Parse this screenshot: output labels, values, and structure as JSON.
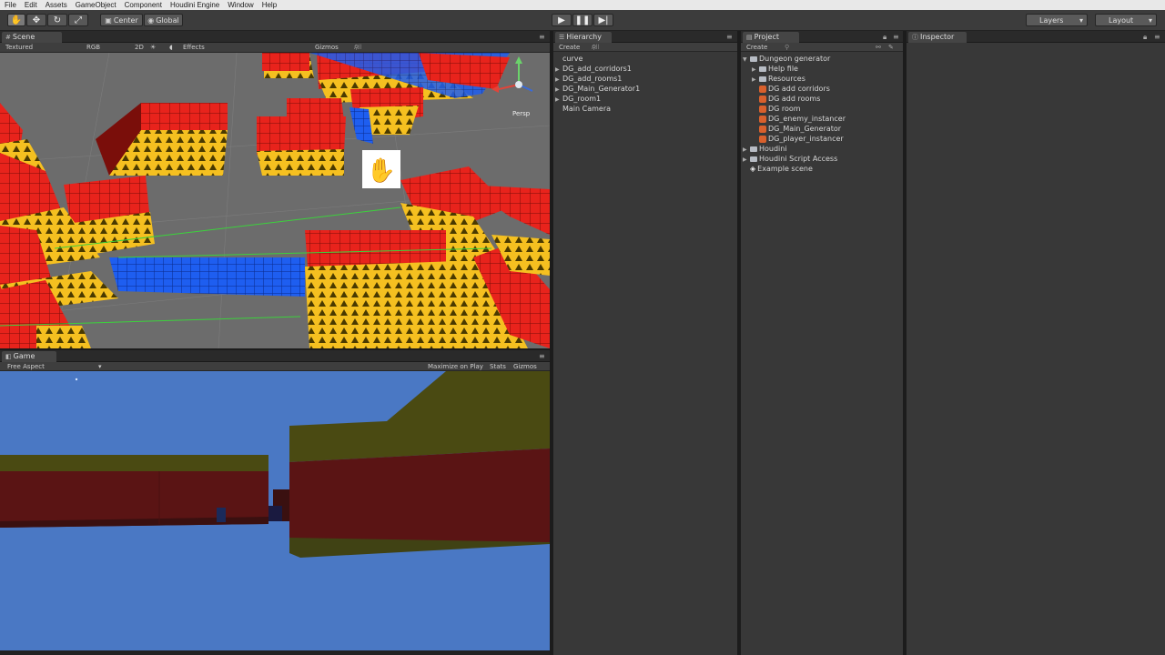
{
  "menu": [
    "File",
    "Edit",
    "Assets",
    "GameObject",
    "Component",
    "Houdini Engine",
    "Window",
    "Help"
  ],
  "toolbar": {
    "tools": [
      "hand-tool",
      "move-tool",
      "rotate-tool",
      "scale-tool"
    ],
    "pivot_mode": "Center",
    "pivot_rotation": "Global",
    "layers_label": "Layers",
    "layout_label": "Layout"
  },
  "scene": {
    "tab_label": "Scene",
    "render_mode": "Textured",
    "color_mode": "RGB",
    "mode_2d": "2D",
    "effects_label": "Effects",
    "gizmos_label": "Gizmos",
    "search_placeholder": "All",
    "persp_label": "Persp"
  },
  "game": {
    "tab_label": "Game",
    "aspect": "Free Aspect",
    "maximize_label": "Maximize on Play",
    "stats_label": "Stats",
    "gizmos_label": "Gizmos"
  },
  "hierarchy": {
    "tab_label": "Hierarchy",
    "create_label": "Create",
    "search_placeholder": "All",
    "items": [
      {
        "label": "curve",
        "expandable": false
      },
      {
        "label": "DG_add_corridors1",
        "expandable": true
      },
      {
        "label": "DG_add_rooms1",
        "expandable": true
      },
      {
        "label": "DG_Main_Generator1",
        "expandable": true
      },
      {
        "label": "DG_room1",
        "expandable": true
      },
      {
        "label": "Main Camera",
        "expandable": false
      }
    ]
  },
  "project": {
    "tab_label": "Project",
    "create_label": "Create",
    "items": [
      {
        "label": "Dungeon generator",
        "type": "folder",
        "expanded": true
      },
      {
        "label": "Help file",
        "type": "folder"
      },
      {
        "label": "Resources",
        "type": "folder"
      },
      {
        "label": "DG add corridors",
        "type": "asset"
      },
      {
        "label": "DG add rooms",
        "type": "asset"
      },
      {
        "label": "DG room",
        "type": "asset"
      },
      {
        "label": "DG_enemy_instancer",
        "type": "asset"
      },
      {
        "label": "DG_Main_Generator",
        "type": "asset"
      },
      {
        "label": "DG_player_instancer",
        "type": "asset"
      },
      {
        "label": "Houdini",
        "type": "folder"
      },
      {
        "label": "Houdini Script Access",
        "type": "folder"
      },
      {
        "label": "Example scene",
        "type": "scene"
      }
    ]
  },
  "inspector": {
    "tab_label": "Inspector"
  },
  "colors": {
    "accent_red": "#e8231c",
    "accent_yellow": "#f5c020",
    "accent_blue": "#1e5ef0",
    "sky": "#4a78c4"
  }
}
